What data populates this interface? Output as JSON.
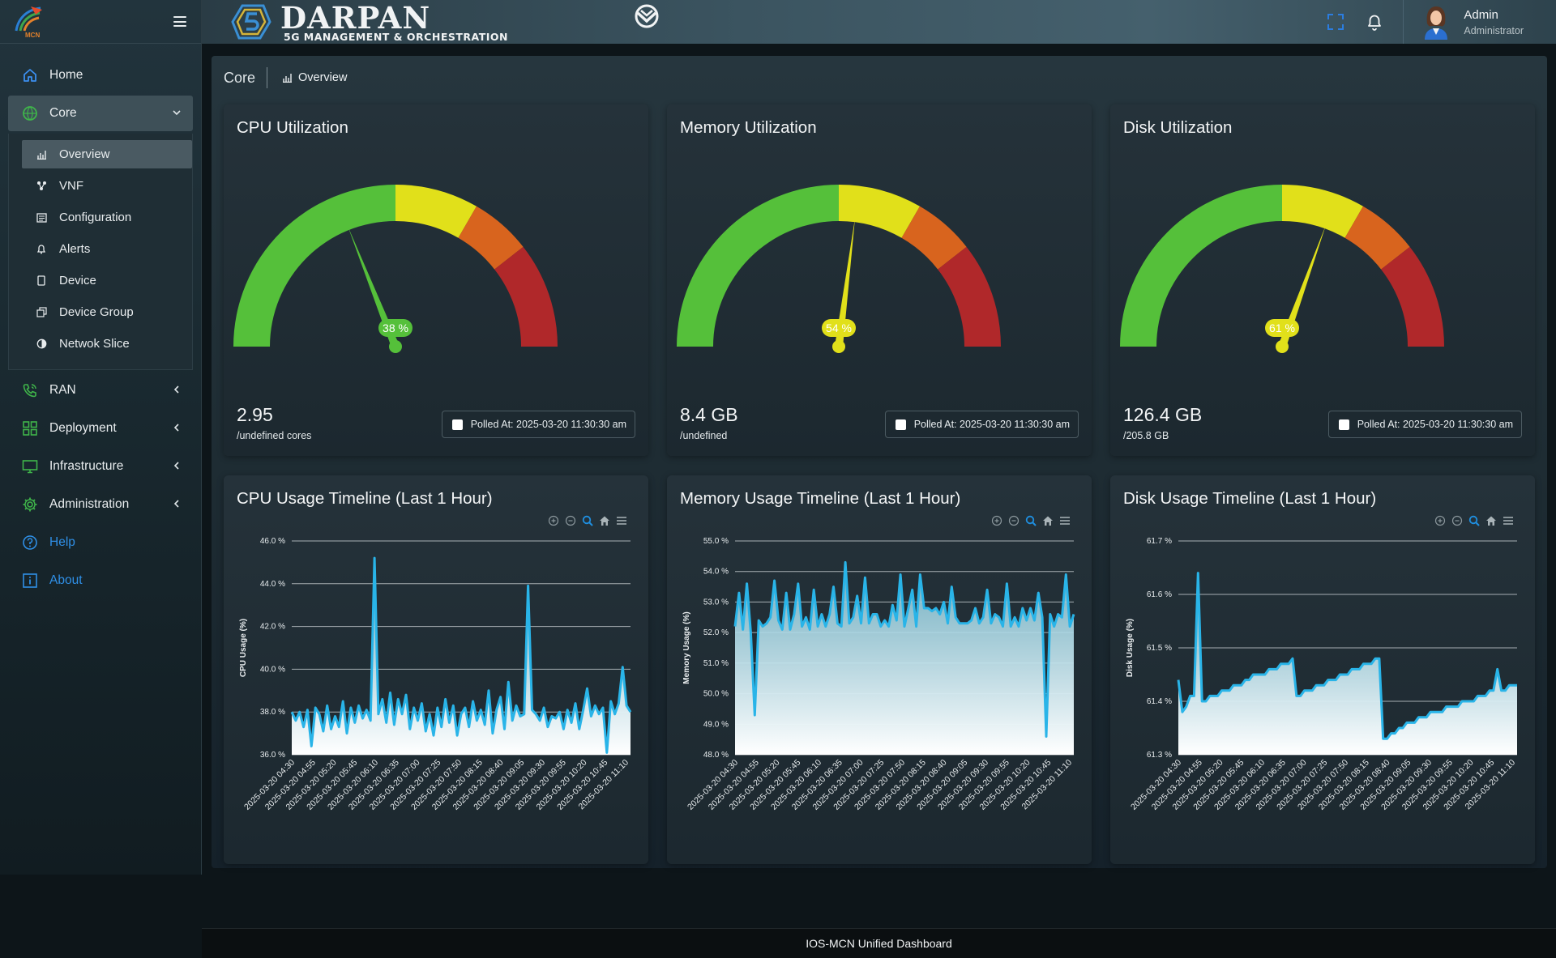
{
  "brand": {
    "logo_text": "MCN"
  },
  "header": {
    "title": "DARPAN",
    "subtitle": "5G MANAGEMENT & ORCHESTRATION",
    "user_name": "Admin",
    "user_role": "Administrator"
  },
  "sidebar": {
    "items": [
      {
        "label": "Home",
        "icon": "home-icon"
      },
      {
        "label": "Core",
        "icon": "globe-icon"
      },
      {
        "label": "RAN",
        "icon": "phone-icon"
      },
      {
        "label": "Deployment",
        "icon": "grid-icon"
      },
      {
        "label": "Infrastructure",
        "icon": "monitor-icon"
      },
      {
        "label": "Administration",
        "icon": "gear-icon"
      },
      {
        "label": "Help",
        "icon": "help-icon"
      },
      {
        "label": "About",
        "icon": "info-icon"
      }
    ],
    "core_submenu": [
      {
        "label": "Overview",
        "icon": "bar-chart-icon"
      },
      {
        "label": "VNF",
        "icon": "network-icon"
      },
      {
        "label": "Configuration",
        "icon": "config-icon"
      },
      {
        "label": "Alerts",
        "icon": "bell-icon"
      },
      {
        "label": "Device",
        "icon": "device-icon"
      },
      {
        "label": "Device Group",
        "icon": "device-group-icon"
      },
      {
        "label": "Netwok Slice",
        "icon": "slice-icon"
      }
    ]
  },
  "breadcrumb": {
    "root": "Core",
    "current": "Overview"
  },
  "colors": {
    "green": "#55c03a",
    "yellow": "#e1e01a",
    "orange": "#d8641e",
    "red": "#b0282a",
    "line": "#29b4e8"
  },
  "gauges": [
    {
      "title": "CPU Utilization",
      "value": 38,
      "label": "38 %",
      "big": "2.95",
      "sub": "/undefined cores",
      "polled": "Polled At: 2025-03-20 11:30:30 am"
    },
    {
      "title": "Memory Utilization",
      "value": 54,
      "label": "54 %",
      "big": "8.4 GB",
      "sub": "/undefined",
      "polled": "Polled At: 2025-03-20 11:30:30 am"
    },
    {
      "title": "Disk Utilization",
      "value": 61,
      "label": "61 %",
      "big": "126.4 GB",
      "sub": "/205.8 GB",
      "polled": "Polled At: 2025-03-20 11:30:30 am"
    }
  ],
  "chart_data": [
    {
      "type": "area",
      "title": "CPU Usage Timeline (Last 1 Hour)",
      "ylabel": "CPU Usage (%)",
      "ylim": [
        36,
        46
      ],
      "y_ticks": [
        "46.0 %",
        "44.0 %",
        "42.0 %",
        "40.0 %",
        "38.0 %",
        "36.0 %"
      ],
      "x_ticks": [
        "2025-03-20 04:30",
        "2025-03-20 04:55",
        "2025-03-20 05:20",
        "2025-03-20 05:45",
        "2025-03-20 06:10",
        "2025-03-20 06:35",
        "2025-03-20 07:00",
        "2025-03-20 07:25",
        "2025-03-20 07:50",
        "2025-03-20 08:15",
        "2025-03-20 08:40",
        "2025-03-20 09:05",
        "2025-03-20 09:30",
        "2025-03-20 09:55",
        "2025-03-20 10:20",
        "2025-03-20 10:45",
        "2025-03-20 11:10"
      ],
      "values": [
        38.0,
        37.6,
        38.0,
        37.3,
        38.1,
        36.4,
        38.2,
        37.9,
        37.1,
        38.3,
        37.2,
        37.8,
        37.3,
        38.5,
        37.0,
        38.2,
        37.5,
        38.3,
        37.7,
        38.1,
        37.6,
        45.2,
        37.9,
        38.6,
        37.5,
        38.9,
        37.4,
        38.6,
        37.9,
        38.8,
        37.2,
        38.2,
        37.6,
        38.4,
        37.1,
        37.9,
        36.9,
        38.2,
        37.3,
        38.6,
        37.5,
        38.3,
        36.9,
        37.9,
        38.2,
        37.3,
        38.5,
        37.6,
        38.1,
        37.4,
        39.0,
        37.0,
        38.1,
        38.7,
        37.2,
        39.4,
        37.6,
        38.3,
        37.8,
        37.9,
        43.9,
        38.1,
        37.9,
        37.6,
        38.2,
        37.3,
        37.8,
        37.7,
        38.0,
        37.2,
        38.1,
        37.5,
        38.4,
        37.2,
        38.1,
        39.1,
        37.8,
        38.3,
        37.9,
        38.2,
        36.1,
        38.5,
        37.9,
        38.4,
        40.1,
        38.3,
        38.0
      ]
    },
    {
      "type": "area",
      "title": "Memory Usage Timeline (Last 1 Hour)",
      "ylabel": "Memory Usage (%)",
      "ylim": [
        48,
        55
      ],
      "y_ticks": [
        "55.0 %",
        "54.0 %",
        "53.0 %",
        "52.0 %",
        "51.0 %",
        "50.0 %",
        "49.0 %",
        "48.0 %"
      ],
      "x_ticks": [
        "2025-03-20 04:30",
        "2025-03-20 04:55",
        "2025-03-20 05:20",
        "2025-03-20 05:45",
        "2025-03-20 06:10",
        "2025-03-20 06:35",
        "2025-03-20 07:00",
        "2025-03-20 07:25",
        "2025-03-20 07:50",
        "2025-03-20 08:15",
        "2025-03-20 08:40",
        "2025-03-20 09:05",
        "2025-03-20 09:30",
        "2025-03-20 09:55",
        "2025-03-20 10:20",
        "2025-03-20 10:45",
        "2025-03-20 11:10"
      ],
      "values": [
        52.2,
        53.3,
        52.1,
        53.6,
        52.0,
        49.3,
        52.4,
        52.2,
        52.3,
        52.5,
        53.7,
        52.4,
        52.1,
        53.3,
        52.1,
        52.6,
        53.6,
        52.2,
        52.5,
        52.1,
        53.4,
        52.2,
        52.6,
        52.2,
        52.6,
        53.5,
        52.3,
        52.2,
        54.3,
        52.3,
        52.5,
        53.2,
        52.3,
        53.8,
        52.3,
        52.6,
        52.6,
        52.2,
        52.4,
        52.2,
        52.9,
        52.4,
        53.9,
        52.2,
        52.8,
        53.4,
        52.2,
        53.9,
        52.8,
        52.8,
        52.7,
        52.8,
        52.6,
        53.0,
        52.3,
        53.5,
        52.5,
        52.3,
        52.3,
        52.3,
        52.4,
        52.8,
        52.3,
        52.5,
        53.4,
        52.3,
        52.6,
        52.5,
        52.2,
        53.6,
        52.2,
        52.5,
        52.2,
        52.8,
        52.4,
        52.8,
        52.4,
        53.3,
        52.5,
        48.6,
        52.6,
        52.2,
        52.6,
        52.5,
        53.9,
        52.2,
        52.6
      ]
    },
    {
      "type": "area",
      "title": "Disk Usage Timeline (Last 1 Hour)",
      "ylabel": "Disk Usage (%)",
      "ylim": [
        61.3,
        61.7
      ],
      "y_ticks": [
        "61.7 %",
        "61.6 %",
        "61.5 %",
        "61.4 %",
        "61.3 %"
      ],
      "x_ticks": [
        "2025-03-20 04:30",
        "2025-03-20 04:55",
        "2025-03-20 05:20",
        "2025-03-20 05:45",
        "2025-03-20 06:10",
        "2025-03-20 06:35",
        "2025-03-20 07:00",
        "2025-03-20 07:25",
        "2025-03-20 07:50",
        "2025-03-20 08:15",
        "2025-03-20 08:40",
        "2025-03-20 09:05",
        "2025-03-20 09:30",
        "2025-03-20 09:55",
        "2025-03-20 10:20",
        "2025-03-20 10:45",
        "2025-03-20 11:10"
      ],
      "values": [
        61.44,
        61.38,
        61.39,
        61.41,
        61.41,
        61.64,
        61.4,
        61.4,
        61.41,
        61.41,
        61.41,
        61.42,
        61.42,
        61.42,
        61.43,
        61.43,
        61.43,
        61.44,
        61.44,
        61.45,
        61.45,
        61.45,
        61.45,
        61.46,
        61.46,
        61.46,
        61.47,
        61.47,
        61.47,
        61.48,
        61.41,
        61.41,
        61.42,
        61.42,
        61.42,
        61.43,
        61.43,
        61.43,
        61.44,
        61.44,
        61.44,
        61.45,
        61.45,
        61.45,
        61.46,
        61.46,
        61.46,
        61.47,
        61.47,
        61.47,
        61.48,
        61.48,
        61.33,
        61.33,
        61.34,
        61.34,
        61.35,
        61.35,
        61.36,
        61.36,
        61.36,
        61.37,
        61.37,
        61.37,
        61.38,
        61.38,
        61.38,
        61.38,
        61.39,
        61.39,
        61.39,
        61.39,
        61.4,
        61.4,
        61.4,
        61.4,
        61.41,
        61.41,
        61.41,
        61.42,
        61.42,
        61.46,
        61.42,
        61.42,
        61.43,
        61.43,
        61.43
      ]
    }
  ],
  "footer": {
    "text": "IOS-MCN Unified Dashboard"
  }
}
